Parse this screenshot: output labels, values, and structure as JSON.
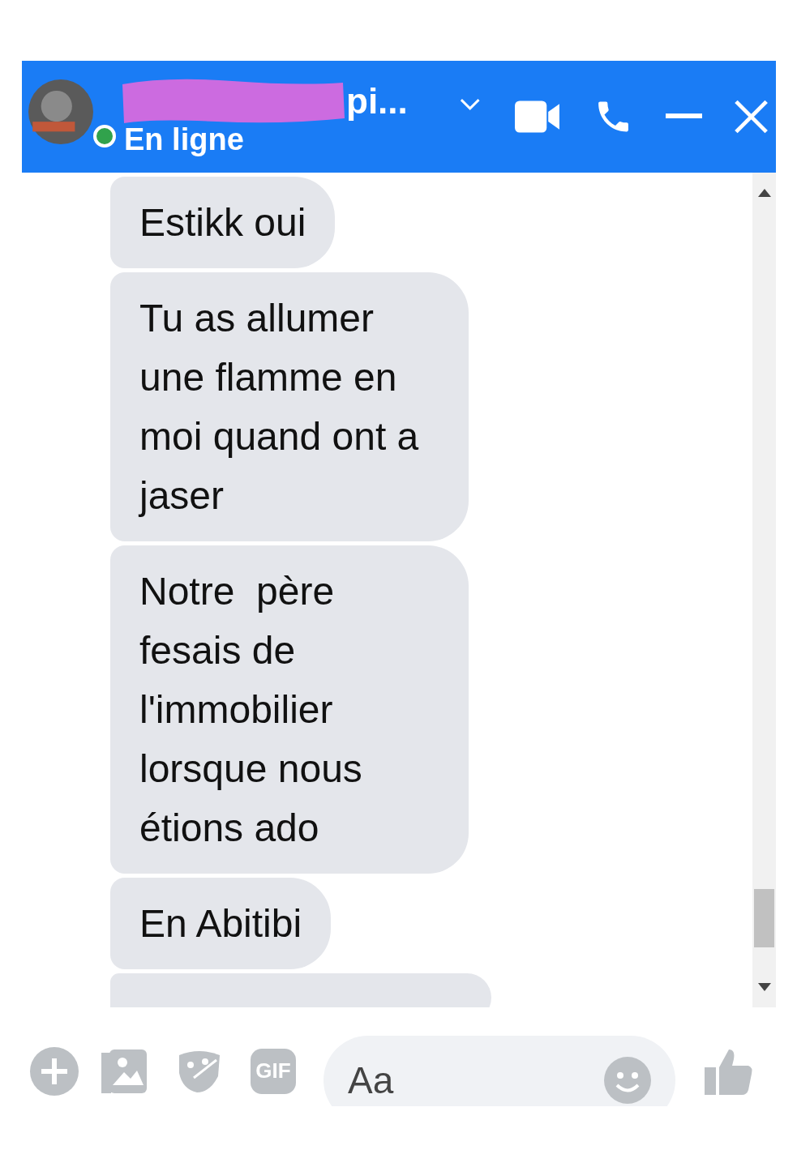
{
  "header": {
    "name": "pi...",
    "status": "En ligne",
    "online": true
  },
  "messages": [
    {
      "text": "Estikk oui"
    },
    {
      "text": "Tu as allumer une flamme en moi quand ont a jaser"
    },
    {
      "text": "Notre  père fesais de l'immobilier lorsque nous étions ado"
    },
    {
      "text": "En Abitibi"
    }
  ],
  "composer": {
    "placeholder": "Aa",
    "gif_label": "GIF"
  }
}
